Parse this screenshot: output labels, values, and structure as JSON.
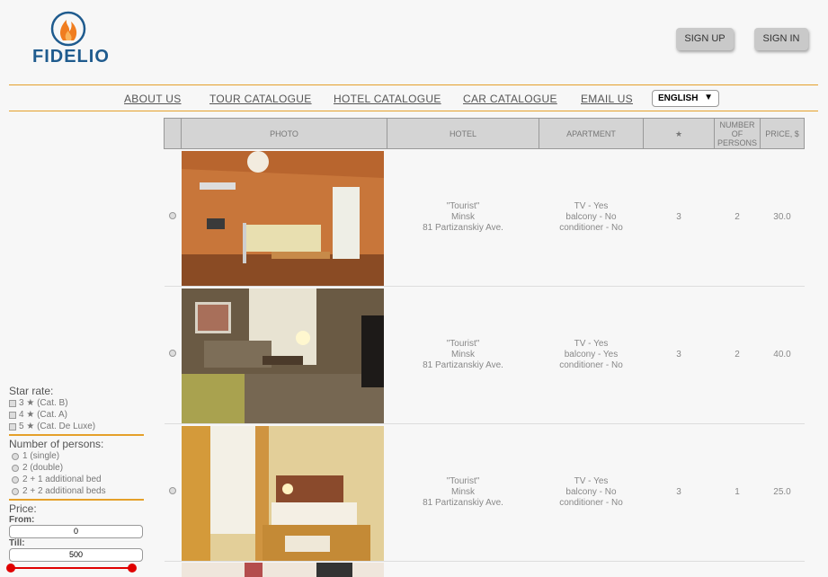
{
  "brand": {
    "name": "FIDELIO",
    "accent": "#e5a02a",
    "blue": "#1f5b8e",
    "flame": "#f07d1f"
  },
  "auth": {
    "signup": "SIGN UP",
    "signin": "SIGN IN"
  },
  "nav": {
    "items": [
      "ABOUT US",
      "TOUR CATALOGUE",
      "HOTEL CATALOGUE",
      "CAR CATALOGUE",
      "EMAIL US"
    ],
    "language": "ENGLISH",
    "dropdown_icon": "caret-down-icon"
  },
  "table": {
    "headers": [
      "",
      "PHOTO",
      "HOTEL",
      "APARTMENT",
      "★",
      "NUMBER OF PERSONS",
      "PRICE, $"
    ],
    "rows": [
      {
        "hotel": [
          "\"Tourist\"",
          "Minsk",
          "81 Partizanskiy Ave."
        ],
        "apartment": [
          "TV - Yes",
          "balcony - No",
          "conditioner - No"
        ],
        "stars": "3",
        "persons": "2",
        "price": "30.0"
      },
      {
        "hotel": [
          "\"Tourist\"",
          "Minsk",
          "81 Partizanskiy Ave."
        ],
        "apartment": [
          "TV - Yes",
          "balcony - Yes",
          "conditioner - No"
        ],
        "stars": "3",
        "persons": "2",
        "price": "40.0"
      },
      {
        "hotel": [
          "\"Tourist\"",
          "Minsk",
          "81 Partizanskiy Ave."
        ],
        "apartment": [
          "TV - Yes",
          "balcony - No",
          "conditioner - No"
        ],
        "stars": "3",
        "persons": "1",
        "price": "25.0"
      }
    ]
  },
  "filters": {
    "star_title": "Star rate:",
    "star_options": [
      "3 ★ (Cat. B)",
      "4 ★ (Cat. A)",
      "5 ★ (Cat. De Luxe)"
    ],
    "persons_title": "Number of persons:",
    "persons_options": [
      "1 (single)",
      "2 (double)",
      "2 + 1 additional bed",
      "2 + 2 additional beds"
    ],
    "price_title": "Price:",
    "from_label": "From:",
    "from_value": "0",
    "till_label": "Till:",
    "till_value": "500"
  }
}
